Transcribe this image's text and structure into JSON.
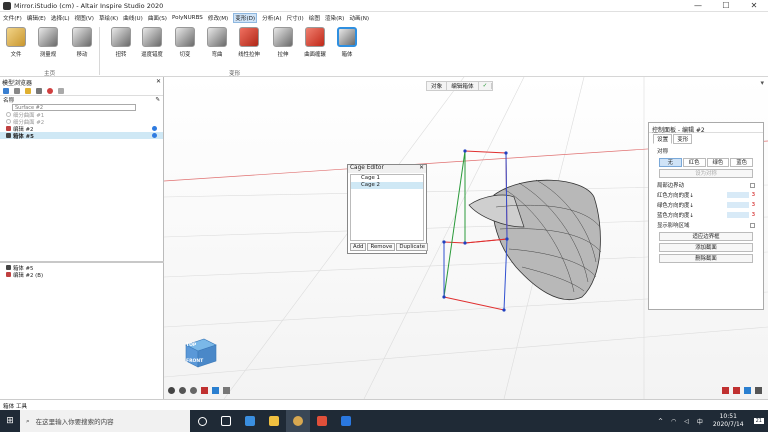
{
  "window": {
    "title": "Mirror.iStudio (cm) - Altair Inspire Studio 2020"
  },
  "menu": [
    "文件(F)",
    "编辑(E)",
    "选择(L)",
    "视图(V)",
    "草绘(K)",
    "曲线(U)",
    "曲面(S)",
    "PolyNURBS",
    "修改(M)",
    "变形(D)",
    "分析(A)",
    "尺寸(I)",
    "绘图",
    "渲染(R)",
    "动画(N)"
  ],
  "menu_active": "变形(D)",
  "ribbon": {
    "tools": [
      {
        "label": "文件"
      },
      {
        "label": "测量规"
      },
      {
        "label": "移动"
      },
      {
        "label": "扭转"
      },
      {
        "label": "逼度错度"
      },
      {
        "label": "切变"
      },
      {
        "label": "弯曲"
      },
      {
        "label": "线性拉伸"
      },
      {
        "label": "拉伸"
      },
      {
        "label": "曲面缠辗"
      },
      {
        "label": "箱体"
      }
    ],
    "groups": [
      "主页",
      "变形"
    ]
  },
  "left_panel": {
    "title": "模型浏览器",
    "column": "名称",
    "search_placeholder": "Surface #2",
    "items": [
      {
        "label": "细分曲面 #1",
        "dim": true
      },
      {
        "label": "细分曲面 #2",
        "dim": true
      },
      {
        "label": "编辑 #2",
        "dim": false
      },
      {
        "label": "箱体 #5",
        "dim": false
      }
    ],
    "lower_items": [
      "箱体 #5",
      "编辑 #2 (B)"
    ]
  },
  "viewport": {
    "toolbar": [
      "对象",
      "编辑箱体",
      "✓"
    ],
    "cube_top": "TOP",
    "cube_front": "FRONT"
  },
  "cage_editor": {
    "title": "Cage Editor",
    "items": [
      "Cage 1",
      "Cage 2"
    ],
    "selected": 1,
    "buttons": [
      "Add",
      "Remove",
      "Duplicate"
    ]
  },
  "control_panel": {
    "title": "控制面板 - 编辑 #2",
    "tabs": [
      "设置",
      "变形"
    ],
    "symmetry_label": "对称",
    "colors": [
      "无",
      "红色",
      "绿色",
      "蓝色"
    ],
    "as_sym": "设为对称",
    "rows": [
      {
        "label": "局部边界动",
        "type": "check"
      },
      {
        "label": "红色方向的度↓",
        "value": "3"
      },
      {
        "label": "绿色方向的度↓",
        "value": "3"
      },
      {
        "label": "蓝色方向的度↓",
        "value": "3"
      },
      {
        "label": "显示影响区域",
        "type": "check"
      }
    ],
    "buttons": [
      "适应边界框",
      "添加截面",
      "删除截面"
    ]
  },
  "status": {
    "text": "箱体 工具"
  },
  "taskbar": {
    "search": "在这里输入你要搜索的内容",
    "time": "10:51",
    "date": "2020/7/14",
    "lang": "中",
    "notif": "21"
  }
}
